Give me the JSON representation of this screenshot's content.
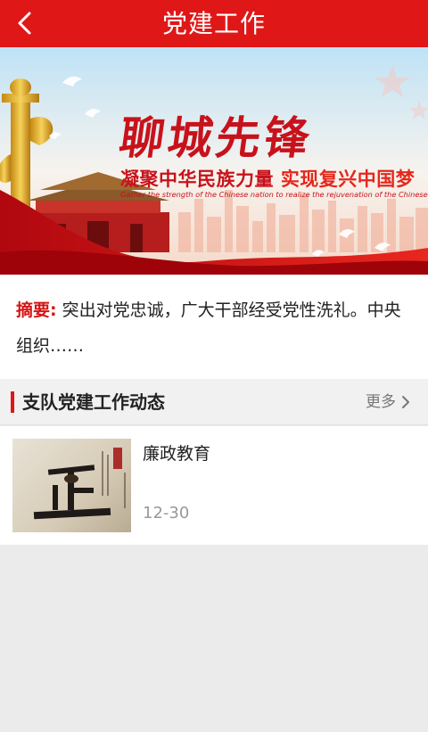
{
  "header": {
    "title": "党建工作",
    "back_icon": "chevron-left-icon"
  },
  "banner": {
    "slogan_main": "聊城先锋",
    "slogan_sub_part1": "凝聚中华民族力量",
    "slogan_sub_part2": "实现复兴中国梦",
    "slogan_en": "Gather the strength of the Chinese nation to realize the rejuvenation of the Chinese dream"
  },
  "summary": {
    "label": "摘要:",
    "text": "突出对党忠诚，广大干部经受党性洗礼。中央组织……"
  },
  "section": {
    "title": "支队党建工作动态",
    "more_label": "更多"
  },
  "news": [
    {
      "title": "廉政教育",
      "date": "12-30"
    }
  ],
  "colors": {
    "brand_red": "#e01717",
    "summary_label": "#d51414",
    "date_gray": "#999999"
  }
}
